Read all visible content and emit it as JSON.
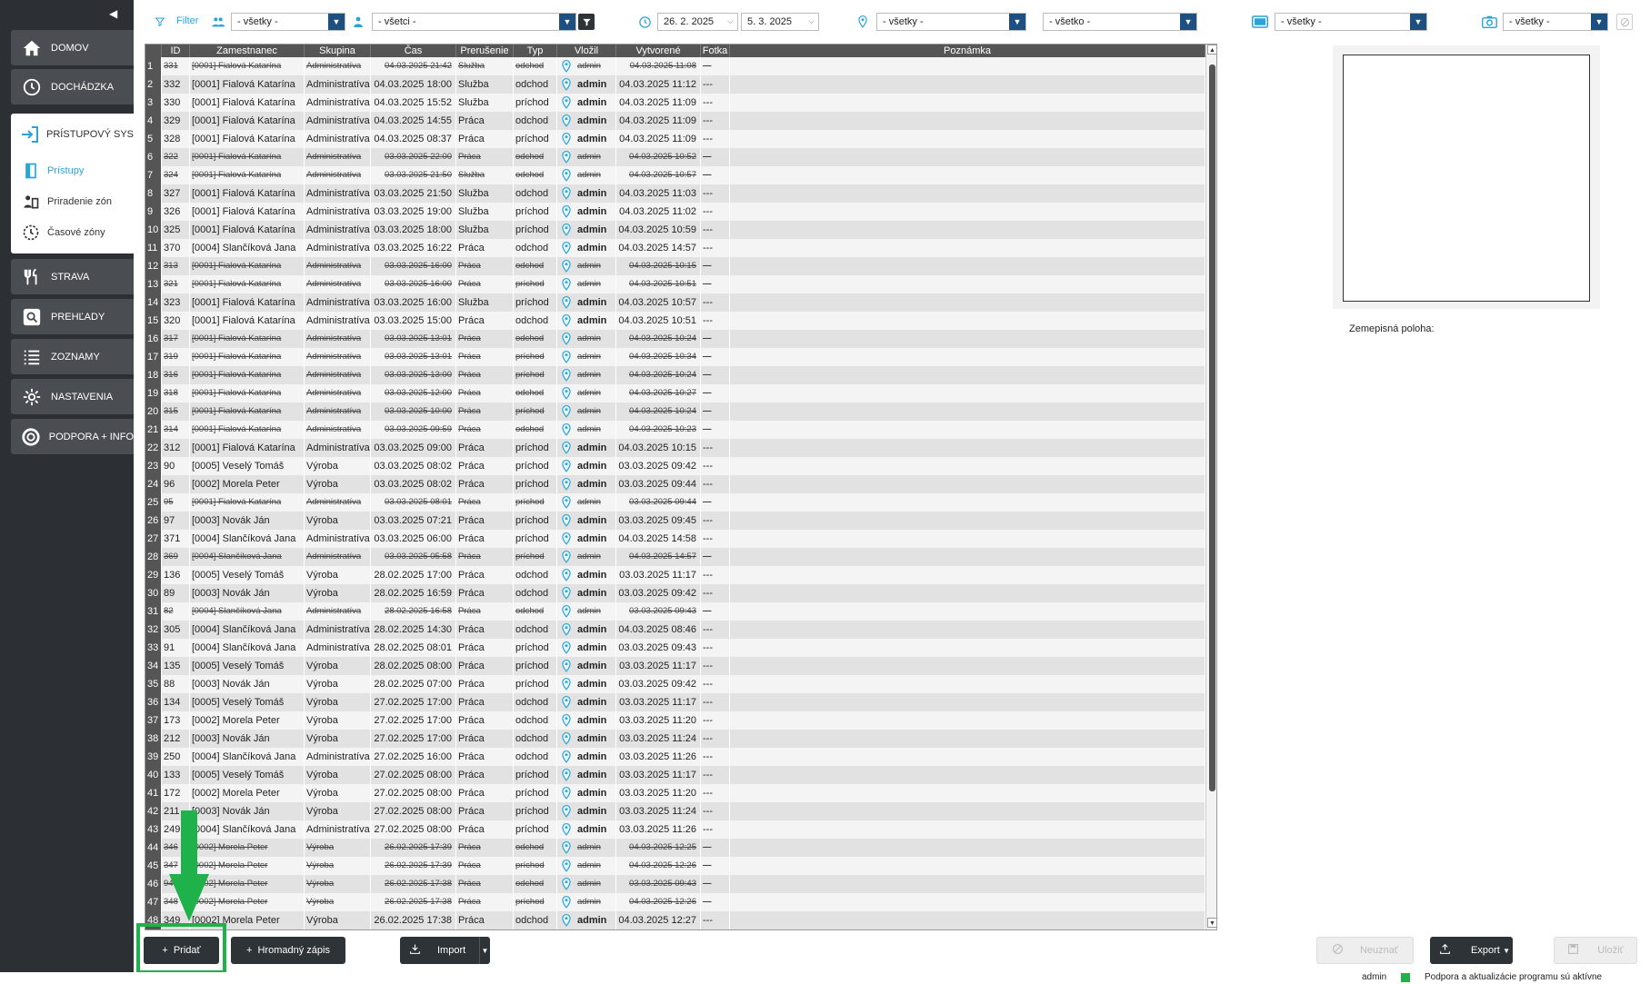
{
  "sidebar": {
    "collapse_glyph": "◀",
    "items": [
      {
        "id": "domov",
        "label": "DOMOV",
        "icon": "home-icon"
      },
      {
        "id": "dochadzka",
        "label": "DOCHÁDZKA",
        "icon": "clock-icon"
      },
      {
        "id": "strava",
        "label": "STRAVA",
        "icon": "cutlery-icon"
      },
      {
        "id": "prehlady",
        "label": "PREHĽADY",
        "icon": "search-icon"
      },
      {
        "id": "zoznamy",
        "label": "ZOZNAMY",
        "icon": "list-icon"
      },
      {
        "id": "nastavenia",
        "label": "NASTAVENIA",
        "icon": "gear-icon"
      },
      {
        "id": "podpora",
        "label": "PODPORA + INFO",
        "icon": "lifebuoy-icon"
      }
    ],
    "section": {
      "label": "PRÍSTUPOVÝ SYS",
      "icon": "door-enter-icon",
      "subitems": [
        {
          "label": "Prístupy",
          "icon": "door-icon",
          "active": true
        },
        {
          "label": "Priradenie zón",
          "icon": "people-zones-icon",
          "active": false
        },
        {
          "label": "Časové zóny",
          "icon": "clock-zones-icon",
          "active": false
        }
      ]
    }
  },
  "filterbar": {
    "label": "Filter",
    "group": "- všetky -",
    "employee": "- všetci -",
    "date_from": "26. 2. 2025",
    "date_to": "5. 3. 2025",
    "location": "- všetky -",
    "type": "- všetko -",
    "device": "- všetky -",
    "camera": "- všetky -"
  },
  "grid": {
    "columns": [
      "ID",
      "Zamestnanec",
      "Skupina",
      "Čas",
      "Prerušenie",
      "Typ",
      "Vložil",
      "Vytvorené",
      "Fotka",
      "Poznámka"
    ],
    "rows": [
      {
        "n": "1",
        "id": "331",
        "emp": "[0001] Fialová Katarína",
        "grp": "Administratíva",
        "cas": "04.03.2025 21:42",
        "pre": "Služba",
        "typ": "odchod",
        "voz": "admin",
        "vyt": "04.03.2025 11:08",
        "fot": "---",
        "del": true
      },
      {
        "n": "2",
        "id": "332",
        "emp": "[0001] Fialová Katarína",
        "grp": "Administratíva",
        "cas": "04.03.2025 18:00",
        "pre": "Služba",
        "typ": "odchod",
        "voz": "admin",
        "vyt": "04.03.2025 11:12",
        "fot": "---",
        "del": false
      },
      {
        "n": "3",
        "id": "330",
        "emp": "[0001] Fialová Katarína",
        "grp": "Administratíva",
        "cas": "04.03.2025 15:52",
        "pre": "Služba",
        "typ": "príchod",
        "voz": "admin",
        "vyt": "04.03.2025 11:09",
        "fot": "---",
        "del": false
      },
      {
        "n": "4",
        "id": "329",
        "emp": "[0001] Fialová Katarína",
        "grp": "Administratíva",
        "cas": "04.03.2025 14:55",
        "pre": "Práca",
        "typ": "odchod",
        "voz": "admin",
        "vyt": "04.03.2025 11:09",
        "fot": "---",
        "del": false
      },
      {
        "n": "5",
        "id": "328",
        "emp": "[0001] Fialová Katarína",
        "grp": "Administratíva",
        "cas": "04.03.2025 08:37",
        "pre": "Práca",
        "typ": "príchod",
        "voz": "admin",
        "vyt": "04.03.2025 11:09",
        "fot": "---",
        "del": false
      },
      {
        "n": "6",
        "id": "322",
        "emp": "[0001] Fialová Katarína",
        "grp": "Administratíva",
        "cas": "03.03.2025 22:00",
        "pre": "Práca",
        "typ": "odchod",
        "voz": "admin",
        "vyt": "04.03.2025 10:52",
        "fot": "---",
        "del": true
      },
      {
        "n": "7",
        "id": "324",
        "emp": "[0001] Fialová Katarína",
        "grp": "Administratíva",
        "cas": "03.03.2025 21:50",
        "pre": "Služba",
        "typ": "odchod",
        "voz": "admin",
        "vyt": "04.03.2025 10:57",
        "fot": "---",
        "del": true
      },
      {
        "n": "8",
        "id": "327",
        "emp": "[0001] Fialová Katarína",
        "grp": "Administratíva",
        "cas": "03.03.2025 21:50",
        "pre": "Služba",
        "typ": "odchod",
        "voz": "admin",
        "vyt": "04.03.2025 11:03",
        "fot": "---",
        "del": false
      },
      {
        "n": "9",
        "id": "326",
        "emp": "[0001] Fialová Katarína",
        "grp": "Administratíva",
        "cas": "03.03.2025 19:00",
        "pre": "Služba",
        "typ": "príchod",
        "voz": "admin",
        "vyt": "04.03.2025 11:02",
        "fot": "---",
        "del": false
      },
      {
        "n": "10",
        "id": "325",
        "emp": "[0001] Fialová Katarína",
        "grp": "Administratíva",
        "cas": "03.03.2025 18:00",
        "pre": "Služba",
        "typ": "príchod",
        "voz": "admin",
        "vyt": "04.03.2025 10:59",
        "fot": "---",
        "del": false
      },
      {
        "n": "11",
        "id": "370",
        "emp": "[0004] Slančíková Jana",
        "grp": "Administratíva",
        "cas": "03.03.2025 16:22",
        "pre": "Práca",
        "typ": "odchod",
        "voz": "admin",
        "vyt": "04.03.2025 14:57",
        "fot": "---",
        "del": false
      },
      {
        "n": "12",
        "id": "313",
        "emp": "[0001] Fialová Katarína",
        "grp": "Administratíva",
        "cas": "03.03.2025 16:00",
        "pre": "Práca",
        "typ": "odchod",
        "voz": "admin",
        "vyt": "04.03.2025 10:15",
        "fot": "---",
        "del": true
      },
      {
        "n": "13",
        "id": "321",
        "emp": "[0001] Fialová Katarína",
        "grp": "Administratíva",
        "cas": "03.03.2025 16:00",
        "pre": "Práca",
        "typ": "príchod",
        "voz": "admin",
        "vyt": "04.03.2025 10:51",
        "fot": "---",
        "del": true
      },
      {
        "n": "14",
        "id": "323",
        "emp": "[0001] Fialová Katarína",
        "grp": "Administratíva",
        "cas": "03.03.2025 16:00",
        "pre": "Služba",
        "typ": "príchod",
        "voz": "admin",
        "vyt": "04.03.2025 10:57",
        "fot": "---",
        "del": false
      },
      {
        "n": "15",
        "id": "320",
        "emp": "[0001] Fialová Katarína",
        "grp": "Administratíva",
        "cas": "03.03.2025 15:00",
        "pre": "Práca",
        "typ": "odchod",
        "voz": "admin",
        "vyt": "04.03.2025 10:51",
        "fot": "---",
        "del": false
      },
      {
        "n": "16",
        "id": "317",
        "emp": "[0001] Fialová Katarína",
        "grp": "Administratíva",
        "cas": "03.03.2025 13:01",
        "pre": "Práca",
        "typ": "odchod",
        "voz": "admin",
        "vyt": "04.03.2025 10:24",
        "fot": "---",
        "del": true
      },
      {
        "n": "17",
        "id": "319",
        "emp": "[0001] Fialová Katarína",
        "grp": "Administratíva",
        "cas": "03.03.2025 13:01",
        "pre": "Práca",
        "typ": "príchod",
        "voz": "admin",
        "vyt": "04.03.2025 10:34",
        "fot": "---",
        "del": true
      },
      {
        "n": "18",
        "id": "316",
        "emp": "[0001] Fialová Katarína",
        "grp": "Administratíva",
        "cas": "03.03.2025 13:00",
        "pre": "Práca",
        "typ": "príchod",
        "voz": "admin",
        "vyt": "04.03.2025 10:24",
        "fot": "---",
        "del": true
      },
      {
        "n": "19",
        "id": "318",
        "emp": "[0001] Fialová Katarína",
        "grp": "Administratíva",
        "cas": "03.03.2025 12:00",
        "pre": "Práca",
        "typ": "odchod",
        "voz": "admin",
        "vyt": "04.03.2025 10:27",
        "fot": "---",
        "del": true
      },
      {
        "n": "20",
        "id": "315",
        "emp": "[0001] Fialová Katarína",
        "grp": "Administratíva",
        "cas": "03.03.2025 10:00",
        "pre": "Práca",
        "typ": "príchod",
        "voz": "admin",
        "vyt": "04.03.2025 10:24",
        "fot": "---",
        "del": true
      },
      {
        "n": "21",
        "id": "314",
        "emp": "[0001] Fialová Katarína",
        "grp": "Administratíva",
        "cas": "03.03.2025 09:59",
        "pre": "Práca",
        "typ": "odchod",
        "voz": "admin",
        "vyt": "04.03.2025 10:23",
        "fot": "---",
        "del": true
      },
      {
        "n": "22",
        "id": "312",
        "emp": "[0001] Fialová Katarína",
        "grp": "Administratíva",
        "cas": "03.03.2025 09:00",
        "pre": "Práca",
        "typ": "príchod",
        "voz": "admin",
        "vyt": "04.03.2025 10:15",
        "fot": "---",
        "del": false
      },
      {
        "n": "23",
        "id": "90",
        "emp": "[0005] Veselý Tomáš",
        "grp": "Výroba",
        "cas": "03.03.2025 08:02",
        "pre": "Práca",
        "typ": "príchod",
        "voz": "admin",
        "vyt": "03.03.2025 09:42",
        "fot": "---",
        "del": false
      },
      {
        "n": "24",
        "id": "96",
        "emp": "[0002] Morela Peter",
        "grp": "Výroba",
        "cas": "03.03.2025 08:02",
        "pre": "Práca",
        "typ": "príchod",
        "voz": "admin",
        "vyt": "03.03.2025 09:44",
        "fot": "---",
        "del": false
      },
      {
        "n": "25",
        "id": "95",
        "emp": "[0001] Fialová Katarína",
        "grp": "Administratíva",
        "cas": "03.03.2025 08:01",
        "pre": "Práca",
        "typ": "príchod",
        "voz": "admin",
        "vyt": "03.03.2025 09:44",
        "fot": "---",
        "del": true
      },
      {
        "n": "26",
        "id": "97",
        "emp": "[0003] Novák Ján",
        "grp": "Výroba",
        "cas": "03.03.2025 07:21",
        "pre": "Práca",
        "typ": "príchod",
        "voz": "admin",
        "vyt": "03.03.2025 09:45",
        "fot": "---",
        "del": false
      },
      {
        "n": "27",
        "id": "371",
        "emp": "[0004] Slančíková Jana",
        "grp": "Administratíva",
        "cas": "03.03.2025 06:00",
        "pre": "Práca",
        "typ": "príchod",
        "voz": "admin",
        "vyt": "04.03.2025 14:58",
        "fot": "---",
        "del": false
      },
      {
        "n": "28",
        "id": "369",
        "emp": "[0004] Slančíková Jana",
        "grp": "Administratíva",
        "cas": "03.03.2025 05:58",
        "pre": "Práca",
        "typ": "príchod",
        "voz": "admin",
        "vyt": "04.03.2025 14:57",
        "fot": "---",
        "del": true
      },
      {
        "n": "29",
        "id": "136",
        "emp": "[0005] Veselý Tomáš",
        "grp": "Výroba",
        "cas": "28.02.2025 17:00",
        "pre": "Práca",
        "typ": "odchod",
        "voz": "admin",
        "vyt": "03.03.2025 11:17",
        "fot": "---",
        "del": false
      },
      {
        "n": "30",
        "id": "89",
        "emp": "[0003] Novák Ján",
        "grp": "Výroba",
        "cas": "28.02.2025 16:59",
        "pre": "Práca",
        "typ": "odchod",
        "voz": "admin",
        "vyt": "03.03.2025 09:42",
        "fot": "---",
        "del": false
      },
      {
        "n": "31",
        "id": "82",
        "emp": "[0004] Slančíková Jana",
        "grp": "Administratíva",
        "cas": "28.02.2025 16:58",
        "pre": "Práca",
        "typ": "odchod",
        "voz": "admin",
        "vyt": "03.03.2025 09:43",
        "fot": "---",
        "del": true
      },
      {
        "n": "32",
        "id": "305",
        "emp": "[0004] Slančíková Jana",
        "grp": "Administratíva",
        "cas": "28.02.2025 14:30",
        "pre": "Práca",
        "typ": "odchod",
        "voz": "admin",
        "vyt": "04.03.2025 08:46",
        "fot": "---",
        "del": false
      },
      {
        "n": "33",
        "id": "91",
        "emp": "[0004] Slančíková Jana",
        "grp": "Administratíva",
        "cas": "28.02.2025 08:01",
        "pre": "Práca",
        "typ": "príchod",
        "voz": "admin",
        "vyt": "03.03.2025 09:43",
        "fot": "---",
        "del": false
      },
      {
        "n": "34",
        "id": "135",
        "emp": "[0005] Veselý Tomáš",
        "grp": "Výroba",
        "cas": "28.02.2025 08:00",
        "pre": "Práca",
        "typ": "príchod",
        "voz": "admin",
        "vyt": "03.03.2025 11:17",
        "fot": "---",
        "del": false
      },
      {
        "n": "35",
        "id": "88",
        "emp": "[0003] Novák Ján",
        "grp": "Výroba",
        "cas": "28.02.2025 07:00",
        "pre": "Práca",
        "typ": "príchod",
        "voz": "admin",
        "vyt": "03.03.2025 09:42",
        "fot": "---",
        "del": false
      },
      {
        "n": "36",
        "id": "134",
        "emp": "[0005] Veselý Tomáš",
        "grp": "Výroba",
        "cas": "27.02.2025 17:00",
        "pre": "Práca",
        "typ": "odchod",
        "voz": "admin",
        "vyt": "03.03.2025 11:17",
        "fot": "---",
        "del": false
      },
      {
        "n": "37",
        "id": "173",
        "emp": "[0002] Morela Peter",
        "grp": "Výroba",
        "cas": "27.02.2025 17:00",
        "pre": "Práca",
        "typ": "odchod",
        "voz": "admin",
        "vyt": "03.03.2025 11:20",
        "fot": "---",
        "del": false
      },
      {
        "n": "38",
        "id": "212",
        "emp": "[0003] Novák Ján",
        "grp": "Výroba",
        "cas": "27.02.2025 17:00",
        "pre": "Práca",
        "typ": "odchod",
        "voz": "admin",
        "vyt": "03.03.2025 11:24",
        "fot": "---",
        "del": false
      },
      {
        "n": "39",
        "id": "250",
        "emp": "[0004] Slančíková Jana",
        "grp": "Administratíva",
        "cas": "27.02.2025 16:00",
        "pre": "Práca",
        "typ": "odchod",
        "voz": "admin",
        "vyt": "03.03.2025 11:26",
        "fot": "---",
        "del": false
      },
      {
        "n": "40",
        "id": "133",
        "emp": "[0005] Veselý Tomáš",
        "grp": "Výroba",
        "cas": "27.02.2025 08:00",
        "pre": "Práca",
        "typ": "príchod",
        "voz": "admin",
        "vyt": "03.03.2025 11:17",
        "fot": "---",
        "del": false
      },
      {
        "n": "41",
        "id": "172",
        "emp": "[0002] Morela Peter",
        "grp": "Výroba",
        "cas": "27.02.2025 08:00",
        "pre": "Práca",
        "typ": "príchod",
        "voz": "admin",
        "vyt": "03.03.2025 11:20",
        "fot": "---",
        "del": false
      },
      {
        "n": "42",
        "id": "211",
        "emp": "[0003] Novák Ján",
        "grp": "Výroba",
        "cas": "27.02.2025 08:00",
        "pre": "Práca",
        "typ": "príchod",
        "voz": "admin",
        "vyt": "03.03.2025 11:24",
        "fot": "---",
        "del": false
      },
      {
        "n": "43",
        "id": "249",
        "emp": "[0004] Slančíková Jana",
        "grp": "Administratíva",
        "cas": "27.02.2025 08:00",
        "pre": "Práca",
        "typ": "príchod",
        "voz": "admin",
        "vyt": "03.03.2025 11:26",
        "fot": "---",
        "del": false
      },
      {
        "n": "44",
        "id": "346",
        "emp": "[0002] Morela Peter",
        "grp": "Výroba",
        "cas": "26.02.2025 17:39",
        "pre": "Práca",
        "typ": "odchod",
        "voz": "admin",
        "vyt": "04.03.2025 12:25",
        "fot": "---",
        "del": true
      },
      {
        "n": "45",
        "id": "347",
        "emp": "[0002] Morela Peter",
        "grp": "Výroba",
        "cas": "26.02.2025 17:39",
        "pre": "Práca",
        "typ": "príchod",
        "voz": "admin",
        "vyt": "04.03.2025 12:26",
        "fot": "---",
        "del": true
      },
      {
        "n": "46",
        "id": "94",
        "emp": "[0002] Morela Peter",
        "grp": "Výroba",
        "cas": "26.02.2025 17:38",
        "pre": "Práca",
        "typ": "odchod",
        "voz": "admin",
        "vyt": "03.03.2025 09:43",
        "fot": "---",
        "del": true
      },
      {
        "n": "47",
        "id": "348",
        "emp": "[0002] Morela Peter",
        "grp": "Výroba",
        "cas": "26.02.2025 17:38",
        "pre": "Práca",
        "typ": "príchod",
        "voz": "admin",
        "vyt": "04.03.2025 12:26",
        "fot": "---",
        "del": true
      },
      {
        "n": "48",
        "id": "349",
        "emp": "[0002] Morela Peter",
        "grp": "Výroba",
        "cas": "26.02.2025 17:38",
        "pre": "Práca",
        "typ": "odchod",
        "voz": "admin",
        "vyt": "04.03.2025 12:27",
        "fot": "---",
        "del": false
      }
    ]
  },
  "right": {
    "geo_label": "Zemepisná poloha:"
  },
  "buttons": {
    "add": "Pridať",
    "bulk": "Hromadný zápis",
    "import": "Import",
    "reject": "Neuznať",
    "export": "Export",
    "save": "Uložiť"
  },
  "status": {
    "user": "admin",
    "support": "Podpora a aktualizácie programu sú aktívne"
  },
  "colors": {
    "accent": "#2aa3d8",
    "sidebar": "#2c2f33",
    "highlight": "#1fb24b",
    "dropdown": "#1d4f80"
  }
}
